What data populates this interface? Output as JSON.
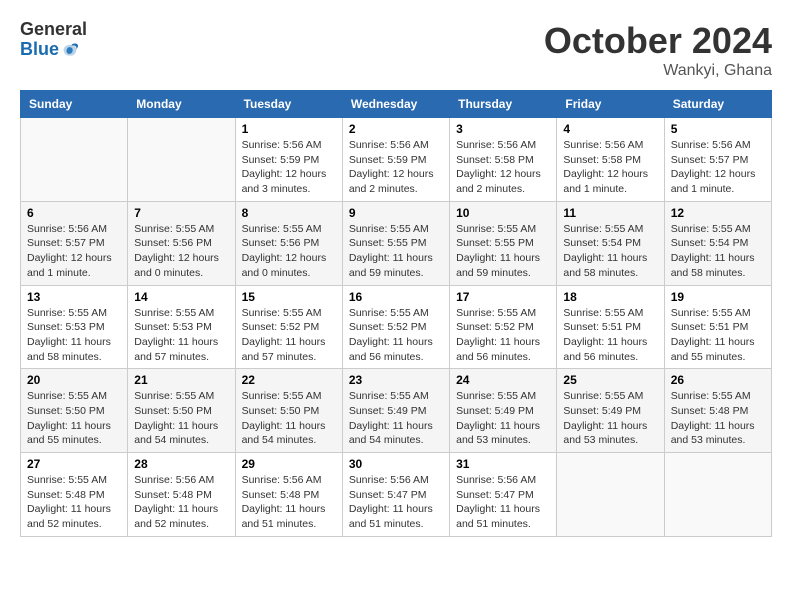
{
  "header": {
    "logo": {
      "general": "General",
      "blue": "Blue"
    },
    "title": "October 2024",
    "location": "Wankyi, Ghana"
  },
  "calendar": {
    "days_of_week": [
      "Sunday",
      "Monday",
      "Tuesday",
      "Wednesday",
      "Thursday",
      "Friday",
      "Saturday"
    ],
    "weeks": [
      [
        {
          "day": "",
          "sunrise": "",
          "sunset": "",
          "daylight": ""
        },
        {
          "day": "",
          "sunrise": "",
          "sunset": "",
          "daylight": ""
        },
        {
          "day": "1",
          "sunrise": "Sunrise: 5:56 AM",
          "sunset": "Sunset: 5:59 PM",
          "daylight": "Daylight: 12 hours and 3 minutes."
        },
        {
          "day": "2",
          "sunrise": "Sunrise: 5:56 AM",
          "sunset": "Sunset: 5:59 PM",
          "daylight": "Daylight: 12 hours and 2 minutes."
        },
        {
          "day": "3",
          "sunrise": "Sunrise: 5:56 AM",
          "sunset": "Sunset: 5:58 PM",
          "daylight": "Daylight: 12 hours and 2 minutes."
        },
        {
          "day": "4",
          "sunrise": "Sunrise: 5:56 AM",
          "sunset": "Sunset: 5:58 PM",
          "daylight": "Daylight: 12 hours and 1 minute."
        },
        {
          "day": "5",
          "sunrise": "Sunrise: 5:56 AM",
          "sunset": "Sunset: 5:57 PM",
          "daylight": "Daylight: 12 hours and 1 minute."
        }
      ],
      [
        {
          "day": "6",
          "sunrise": "Sunrise: 5:56 AM",
          "sunset": "Sunset: 5:57 PM",
          "daylight": "Daylight: 12 hours and 1 minute."
        },
        {
          "day": "7",
          "sunrise": "Sunrise: 5:55 AM",
          "sunset": "Sunset: 5:56 PM",
          "daylight": "Daylight: 12 hours and 0 minutes."
        },
        {
          "day": "8",
          "sunrise": "Sunrise: 5:55 AM",
          "sunset": "Sunset: 5:56 PM",
          "daylight": "Daylight: 12 hours and 0 minutes."
        },
        {
          "day": "9",
          "sunrise": "Sunrise: 5:55 AM",
          "sunset": "Sunset: 5:55 PM",
          "daylight": "Daylight: 11 hours and 59 minutes."
        },
        {
          "day": "10",
          "sunrise": "Sunrise: 5:55 AM",
          "sunset": "Sunset: 5:55 PM",
          "daylight": "Daylight: 11 hours and 59 minutes."
        },
        {
          "day": "11",
          "sunrise": "Sunrise: 5:55 AM",
          "sunset": "Sunset: 5:54 PM",
          "daylight": "Daylight: 11 hours and 58 minutes."
        },
        {
          "day": "12",
          "sunrise": "Sunrise: 5:55 AM",
          "sunset": "Sunset: 5:54 PM",
          "daylight": "Daylight: 11 hours and 58 minutes."
        }
      ],
      [
        {
          "day": "13",
          "sunrise": "Sunrise: 5:55 AM",
          "sunset": "Sunset: 5:53 PM",
          "daylight": "Daylight: 11 hours and 58 minutes."
        },
        {
          "day": "14",
          "sunrise": "Sunrise: 5:55 AM",
          "sunset": "Sunset: 5:53 PM",
          "daylight": "Daylight: 11 hours and 57 minutes."
        },
        {
          "day": "15",
          "sunrise": "Sunrise: 5:55 AM",
          "sunset": "Sunset: 5:52 PM",
          "daylight": "Daylight: 11 hours and 57 minutes."
        },
        {
          "day": "16",
          "sunrise": "Sunrise: 5:55 AM",
          "sunset": "Sunset: 5:52 PM",
          "daylight": "Daylight: 11 hours and 56 minutes."
        },
        {
          "day": "17",
          "sunrise": "Sunrise: 5:55 AM",
          "sunset": "Sunset: 5:52 PM",
          "daylight": "Daylight: 11 hours and 56 minutes."
        },
        {
          "day": "18",
          "sunrise": "Sunrise: 5:55 AM",
          "sunset": "Sunset: 5:51 PM",
          "daylight": "Daylight: 11 hours and 56 minutes."
        },
        {
          "day": "19",
          "sunrise": "Sunrise: 5:55 AM",
          "sunset": "Sunset: 5:51 PM",
          "daylight": "Daylight: 11 hours and 55 minutes."
        }
      ],
      [
        {
          "day": "20",
          "sunrise": "Sunrise: 5:55 AM",
          "sunset": "Sunset: 5:50 PM",
          "daylight": "Daylight: 11 hours and 55 minutes."
        },
        {
          "day": "21",
          "sunrise": "Sunrise: 5:55 AM",
          "sunset": "Sunset: 5:50 PM",
          "daylight": "Daylight: 11 hours and 54 minutes."
        },
        {
          "day": "22",
          "sunrise": "Sunrise: 5:55 AM",
          "sunset": "Sunset: 5:50 PM",
          "daylight": "Daylight: 11 hours and 54 minutes."
        },
        {
          "day": "23",
          "sunrise": "Sunrise: 5:55 AM",
          "sunset": "Sunset: 5:49 PM",
          "daylight": "Daylight: 11 hours and 54 minutes."
        },
        {
          "day": "24",
          "sunrise": "Sunrise: 5:55 AM",
          "sunset": "Sunset: 5:49 PM",
          "daylight": "Daylight: 11 hours and 53 minutes."
        },
        {
          "day": "25",
          "sunrise": "Sunrise: 5:55 AM",
          "sunset": "Sunset: 5:49 PM",
          "daylight": "Daylight: 11 hours and 53 minutes."
        },
        {
          "day": "26",
          "sunrise": "Sunrise: 5:55 AM",
          "sunset": "Sunset: 5:48 PM",
          "daylight": "Daylight: 11 hours and 53 minutes."
        }
      ],
      [
        {
          "day": "27",
          "sunrise": "Sunrise: 5:55 AM",
          "sunset": "Sunset: 5:48 PM",
          "daylight": "Daylight: 11 hours and 52 minutes."
        },
        {
          "day": "28",
          "sunrise": "Sunrise: 5:56 AM",
          "sunset": "Sunset: 5:48 PM",
          "daylight": "Daylight: 11 hours and 52 minutes."
        },
        {
          "day": "29",
          "sunrise": "Sunrise: 5:56 AM",
          "sunset": "Sunset: 5:48 PM",
          "daylight": "Daylight: 11 hours and 51 minutes."
        },
        {
          "day": "30",
          "sunrise": "Sunrise: 5:56 AM",
          "sunset": "Sunset: 5:47 PM",
          "daylight": "Daylight: 11 hours and 51 minutes."
        },
        {
          "day": "31",
          "sunrise": "Sunrise: 5:56 AM",
          "sunset": "Sunset: 5:47 PM",
          "daylight": "Daylight: 11 hours and 51 minutes."
        },
        {
          "day": "",
          "sunrise": "",
          "sunset": "",
          "daylight": ""
        },
        {
          "day": "",
          "sunrise": "",
          "sunset": "",
          "daylight": ""
        }
      ]
    ]
  }
}
